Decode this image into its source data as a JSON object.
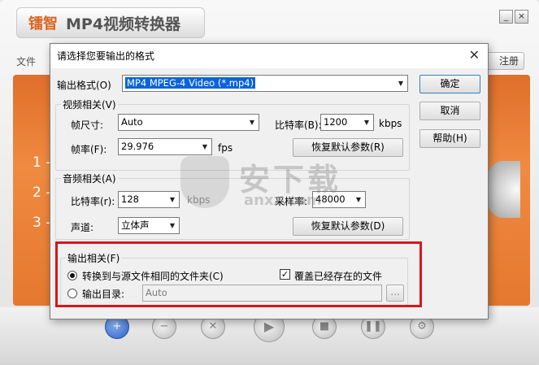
{
  "app": {
    "brand": "镭智",
    "title": "MP4视频转换器",
    "minimize": "_",
    "close": "×",
    "menu_file": "文件",
    "register": "注册",
    "steps": [
      "1 -",
      "2 -",
      "3 -"
    ],
    "colors": {
      "accent": "#e9772f",
      "highlight": "#d8161c",
      "selection": "#0a64d8"
    }
  },
  "watermark": {
    "text": "安下载",
    "domain": "anxz.com"
  },
  "dialog": {
    "title": "请选择您要输出的格式",
    "close": "✕",
    "format_label": "输出格式(O)",
    "format_value": "MP4 MPEG-4 Video (*.mp4)",
    "ok": "确定",
    "cancel": "取消",
    "help": "帮助(H)",
    "video": {
      "title": "视频相关(V)",
      "size_label": "帧尺寸:",
      "size_value": "Auto",
      "bitrate_label": "比特率(B):",
      "bitrate_value": "1200",
      "bitrate_unit": "kbps",
      "fps_label": "帧率(F):",
      "fps_value": "29.976",
      "fps_unit": "fps",
      "reset": "恢复默认参数(R)"
    },
    "audio": {
      "title": "音频相关(A)",
      "bitrate_label": "比特率(r):",
      "bitrate_value": "128",
      "bitrate_unit": "kbps",
      "sample_label": "采样率:",
      "sample_value": "48000",
      "channel_label": "声道:",
      "channel_value": "立体声",
      "reset": "恢复默认参数(D)"
    },
    "output": {
      "title": "输出相关(F)",
      "same_folder": "转换到与源文件相同的文件夹(C)",
      "overwrite": "覆盖已经存在的文件",
      "dir_label": "输出目录:",
      "dir_value": "Auto",
      "browse": "..."
    }
  }
}
